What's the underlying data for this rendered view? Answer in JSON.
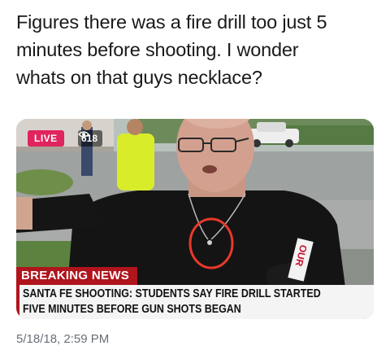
{
  "tweet": {
    "text_lines": [
      "Figures there was a fire drill too just 5",
      "minutes before shooting. I wonder",
      "whats on that guys necklace?"
    ],
    "timestamp": "5/18/18, 2:59 PM"
  },
  "video": {
    "live_label": "LIVE",
    "viewer_icon": "eye-icon",
    "viewer_count": "618",
    "breaking_label": "BREAKING NEWS",
    "headline_lines": [
      "SANTA FE SHOOTING: STUDENTS SAY FIRE DRILL STARTED",
      "FIVE MINUTES BEFORE GUN SHOTS BEGAN"
    ],
    "mic_flag_text": "OUR",
    "colors": {
      "live_badge": "#e0245e",
      "breaking_bar": "#b0141c",
      "annotation_circle": "#e8392b"
    }
  }
}
